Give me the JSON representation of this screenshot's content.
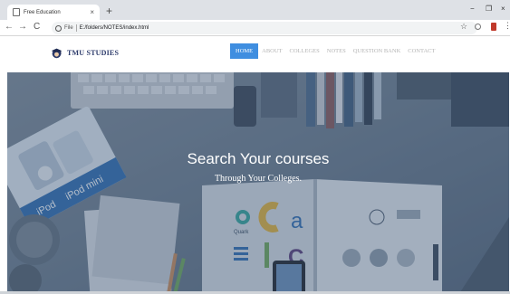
{
  "browser": {
    "tab_title": "Free Education",
    "tab_close": "×",
    "new_tab": "+",
    "back": "←",
    "forward": "→",
    "reload": "C",
    "scheme_label": "File",
    "url": "E:/folders/NOTES/index.html",
    "star": "☆",
    "menu": "⋮",
    "minimize": "−",
    "maximize": "❐",
    "close": "×"
  },
  "site": {
    "brand": "TMU STUDIES",
    "menu": [
      {
        "label": "HOME",
        "active": true
      },
      {
        "label": "ABOUT",
        "active": false
      },
      {
        "label": "COLLEGES",
        "active": false
      },
      {
        "label": "NOTES",
        "active": false
      },
      {
        "label": "QUESTION BANK",
        "active": false
      },
      {
        "label": "CONTACT",
        "active": false
      }
    ]
  },
  "hero": {
    "title": "Search Your courses",
    "subtitle": "Through Your Colleges.",
    "book_labels": {
      "quark": "Quark",
      "ipod": "iPod",
      "ipod_mini": "iPod mini"
    }
  },
  "colors": {
    "accent": "#3f8ee0",
    "brand_text": "#2d3b6b",
    "hero_overlay": "#4a5d77"
  }
}
